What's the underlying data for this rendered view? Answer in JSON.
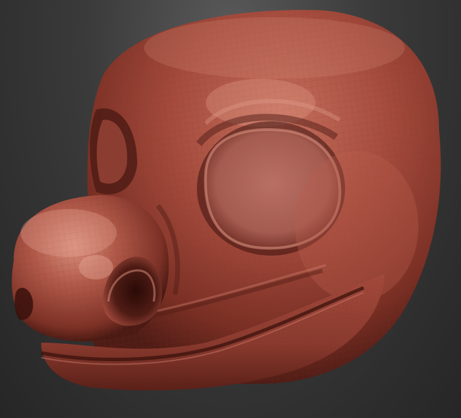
{
  "viewport": {
    "background_top": "#5a5a5a",
    "background_mid": "#3a3a3a",
    "background_bottom": "#262626"
  },
  "model": {
    "subject": "sculpted-creature-head",
    "material": {
      "base": "#a34a3c",
      "highlight": "#d78a78",
      "shadow": "#4f1c15",
      "deep_shadow": "#2c0c08",
      "eye_socket": "#b0685e",
      "wire": "#7e3226"
    },
    "wireframe_visible": true
  }
}
